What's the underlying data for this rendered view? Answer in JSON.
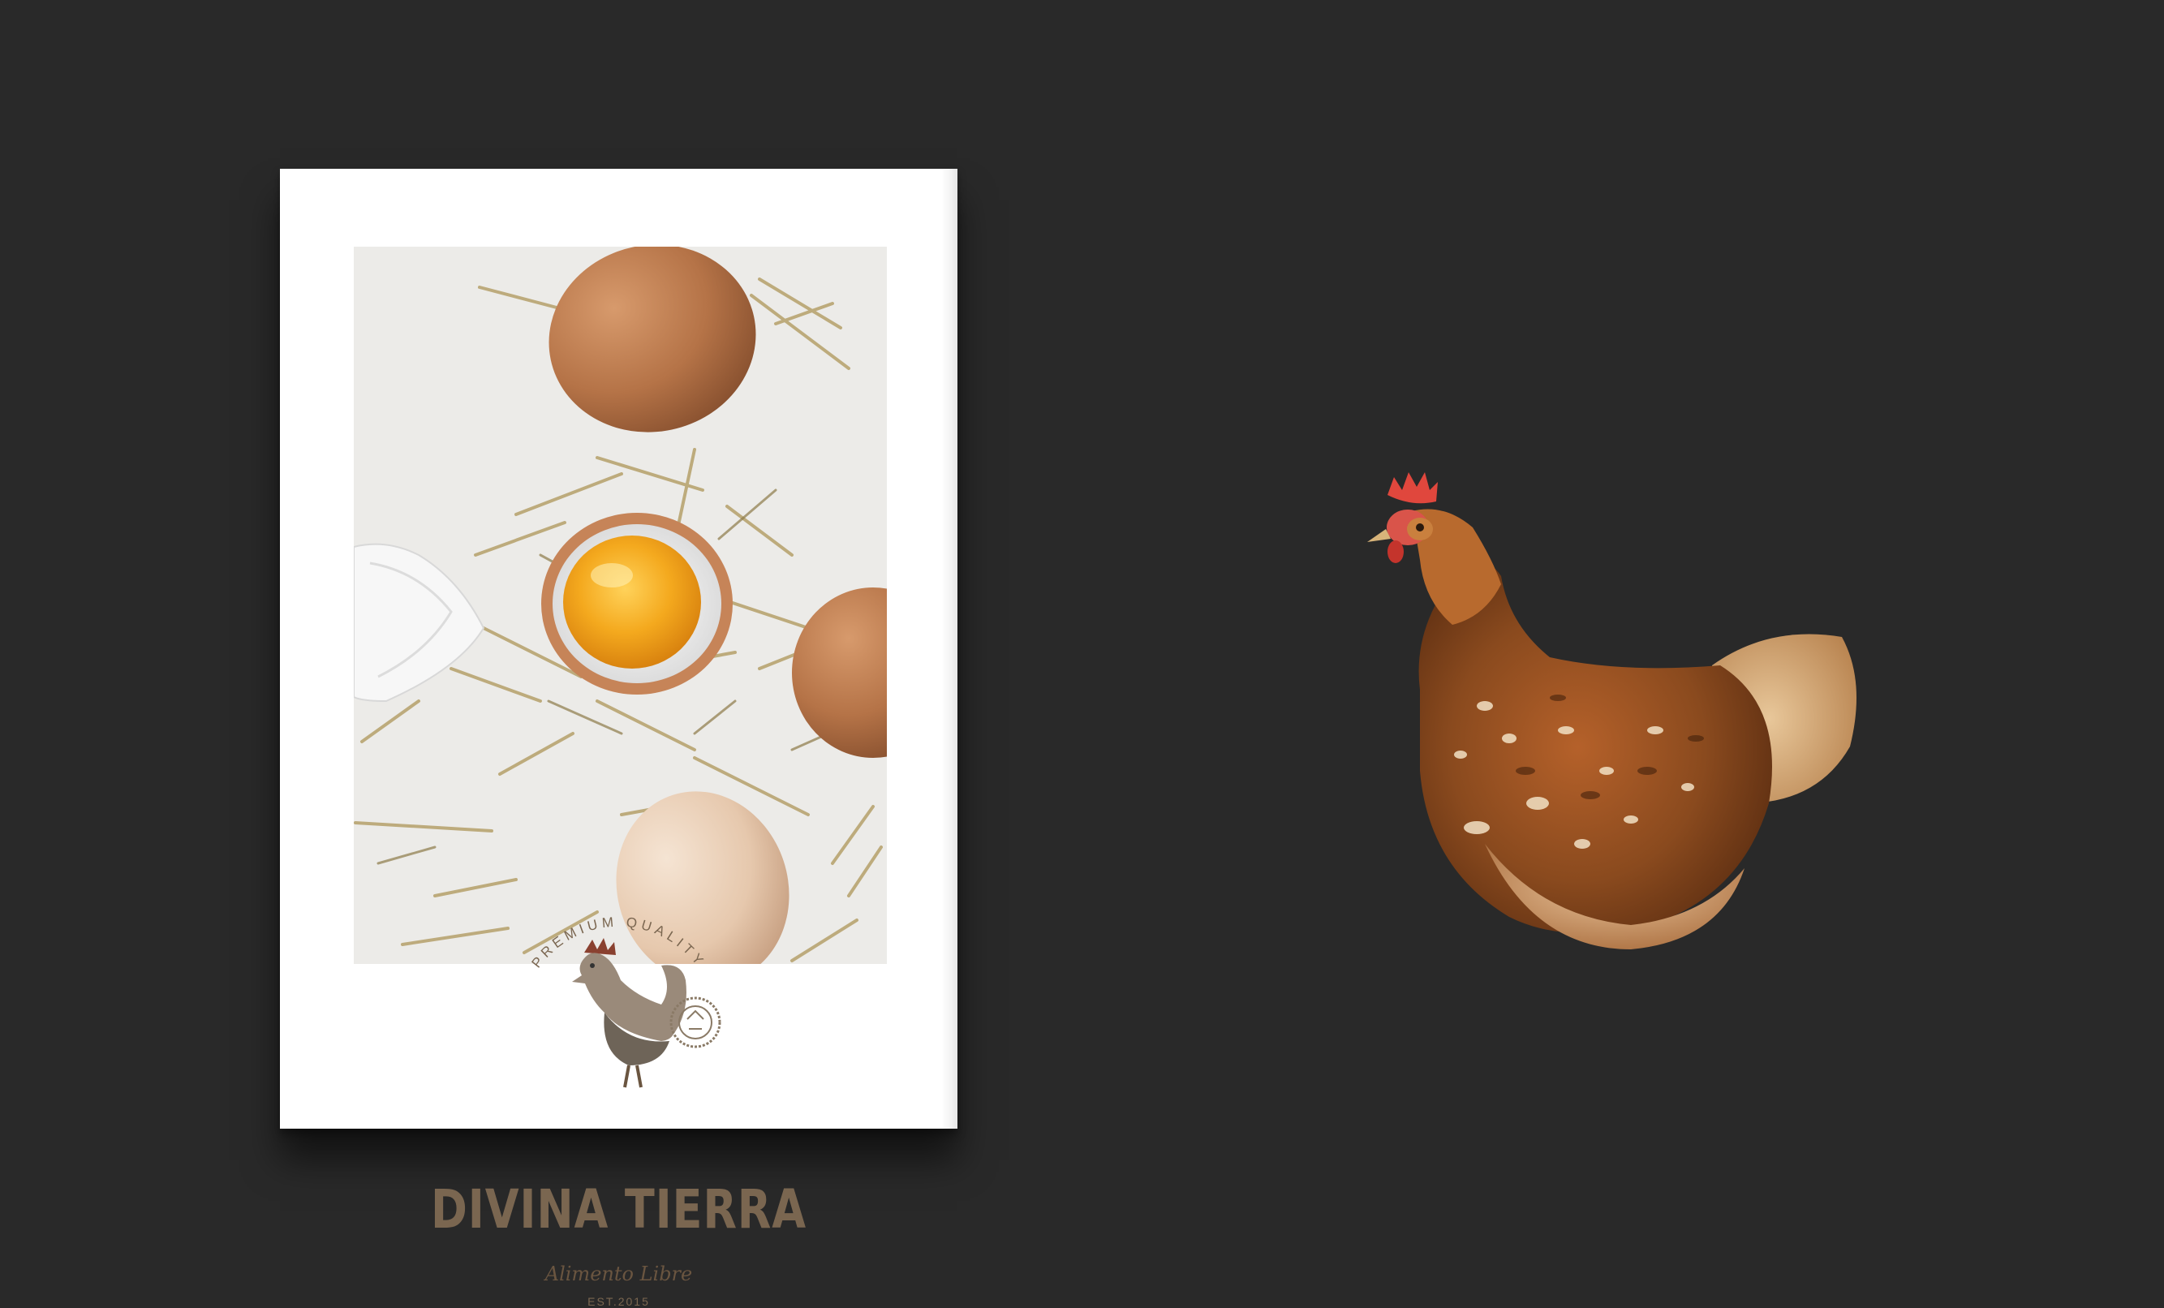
{
  "brand": {
    "badge_arc": "PREMIUM QUALITY",
    "name": "DIVINA TIERRA",
    "tagline": "Alimento Libre",
    "established": "EST.2015"
  },
  "colors": {
    "background": "#292929",
    "paper": "#ffffff",
    "brand_brown": "#7a6650",
    "egg_brown": "#b97a4e",
    "yolk": "#f2a41c",
    "hen_plumage": "#8a4a1e"
  },
  "icons": {
    "logo_mark": "rooster-icon",
    "seal": "stamp-seal-icon"
  }
}
